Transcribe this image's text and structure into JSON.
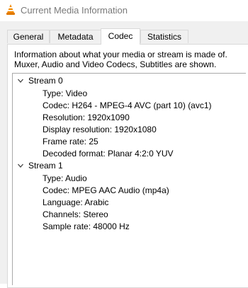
{
  "window": {
    "title": "Current Media Information",
    "icon": "vlc-cone-icon"
  },
  "tabs": [
    {
      "label": "General",
      "active": false
    },
    {
      "label": "Metadata",
      "active": false
    },
    {
      "label": "Codec",
      "active": true
    },
    {
      "label": "Statistics",
      "active": false
    }
  ],
  "codec": {
    "description_line1": "Information about what your media or stream is made of.",
    "description_line2": "Muxer, Audio and Video Codecs, Subtitles are shown.",
    "streams": [
      {
        "label": "Stream 0",
        "expanded": true,
        "properties": [
          "Type: Video",
          "Codec: H264 - MPEG-4 AVC (part 10) (avc1)",
          "Resolution: 1920x1090",
          "Display resolution: 1920x1080",
          "Frame rate: 25",
          "Decoded format: Planar 4:2:0 YUV"
        ]
      },
      {
        "label": "Stream 1",
        "expanded": true,
        "properties": [
          "Type: Audio",
          "Codec: MPEG AAC Audio (mp4a)",
          "Language: Arabic",
          "Channels: Stereo",
          "Sample rate: 48000 Hz"
        ]
      }
    ]
  }
}
